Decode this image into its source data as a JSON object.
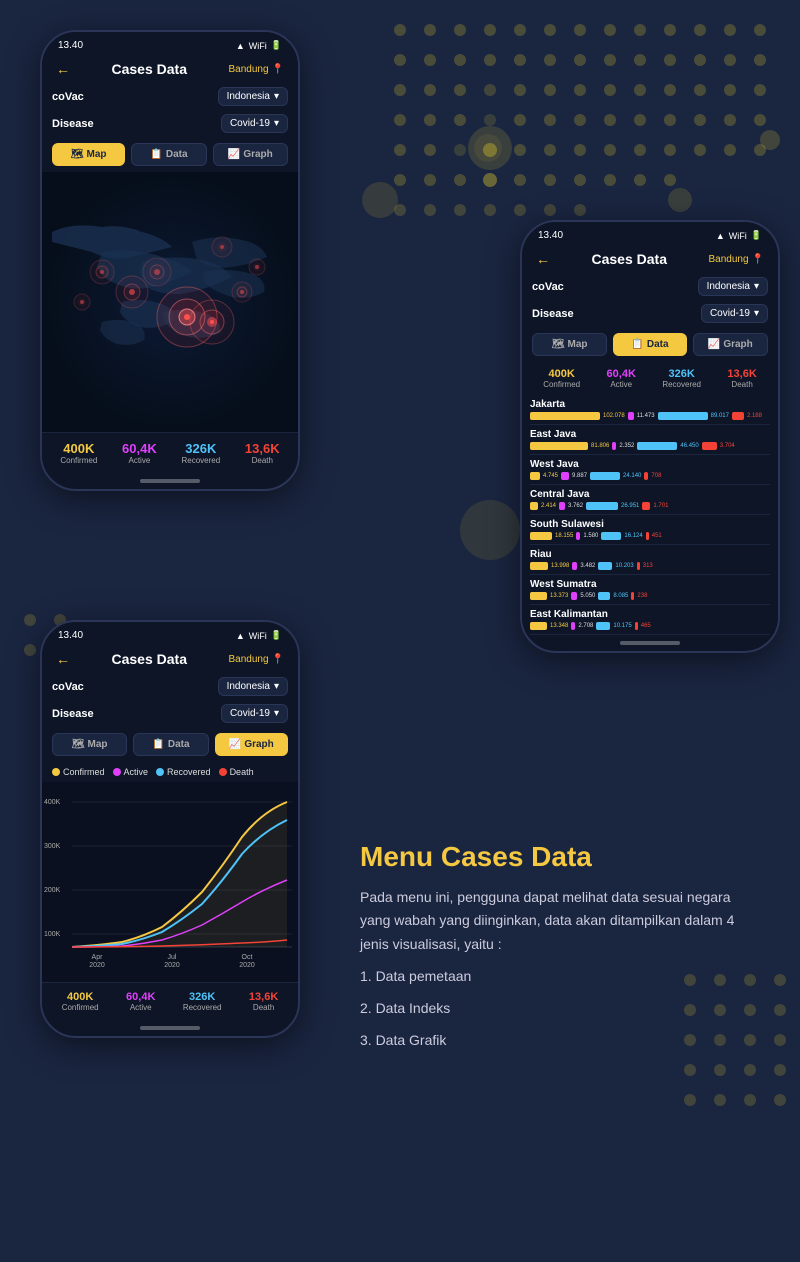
{
  "app": {
    "time": "13.40",
    "title": "Cases Data",
    "location": "Bandung",
    "back_arrow": "←",
    "location_icon": "📍"
  },
  "filters": {
    "covac_label": "coVac",
    "country_label": "Indonesia",
    "disease_label": "Disease",
    "disease_value": "Covid-19"
  },
  "tabs": {
    "map": "Map",
    "data": "Data",
    "graph": "Graph"
  },
  "stats": {
    "confirmed_num": "400K",
    "confirmed_label": "Confirmed",
    "active_num": "60,4K",
    "active_label": "Active",
    "recovered_num": "326K",
    "recovered_label": "Recovered",
    "death_num": "13,6K",
    "death_label": "Death"
  },
  "regions": [
    {
      "name": "Jakarta",
      "confirmed": "102.078",
      "active": "11.473",
      "recovered": "89.017",
      "death": "2.188",
      "c_width": 70,
      "a_width": 6,
      "r_width": 50,
      "d_width": 12
    },
    {
      "name": "East Java",
      "confirmed": "81.806",
      "active": "2.352",
      "recovered": "46.450",
      "death": "3.704",
      "c_width": 58,
      "a_width": 4,
      "r_width": 40,
      "d_width": 15
    },
    {
      "name": "West Java",
      "confirmed": "4.745",
      "active": "9.887",
      "recovered": "24.140",
      "death": "708",
      "c_width": 10,
      "a_width": 8,
      "r_width": 30,
      "d_width": 4
    },
    {
      "name": "Central Java",
      "confirmed": "2.414",
      "active": "3.762",
      "recovered": "26.951",
      "death": "1.701",
      "c_width": 8,
      "a_width": 6,
      "r_width": 32,
      "d_width": 8
    },
    {
      "name": "South Sulawesi",
      "confirmed": "18.155",
      "active": "1.580",
      "recovered": "16.124",
      "death": "451",
      "c_width": 22,
      "a_width": 4,
      "r_width": 20,
      "d_width": 3
    },
    {
      "name": "Riau",
      "confirmed": "13.998",
      "active": "3.482",
      "recovered": "10.203",
      "death": "313",
      "c_width": 18,
      "a_width": 5,
      "r_width": 14,
      "d_width": 2
    },
    {
      "name": "West Sumatra",
      "confirmed": "13.373",
      "active": "5.050",
      "recovered": "8.085",
      "death": "238",
      "c_width": 17,
      "a_width": 6,
      "r_width": 12,
      "d_width": 2
    },
    {
      "name": "East Kalimantan",
      "confirmed": "13.348",
      "active": "2.708",
      "recovered": "10.175",
      "death": "465",
      "c_width": 17,
      "a_width": 4,
      "r_width": 14,
      "d_width": 3
    }
  ],
  "graph": {
    "legend": [
      {
        "label": "Confirmed",
        "color": "#f5c842"
      },
      {
        "label": "Active",
        "color": "#e040fb"
      },
      {
        "label": "Recovered",
        "color": "#4fc3f7"
      },
      {
        "label": "Death",
        "color": "#f44336"
      }
    ],
    "y_labels": [
      "400K",
      "300K",
      "200K",
      "100K"
    ],
    "x_labels": [
      {
        "label": "Apr\n2020",
        "pos": 15
      },
      {
        "label": "Jul\n2020",
        "pos": 45
      },
      {
        "label": "Oct\n2020",
        "pos": 75
      }
    ]
  },
  "text_section": {
    "title": "Menu Cases Data",
    "body": "Pada menu ini, pengguna dapat melihat data sesuai negara yang wabah yang diinginkan, data akan ditampilkan dalam 4 jenis visualisasi, yaitu :",
    "list": [
      "1.  Data pemetaan",
      "2. Data Indeks",
      "3. Data Grafik"
    ]
  }
}
